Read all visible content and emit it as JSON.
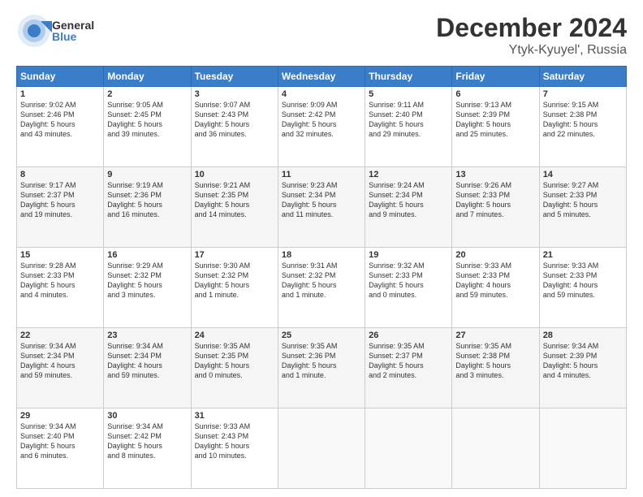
{
  "header": {
    "logo_general": "General",
    "logo_blue": "Blue",
    "title": "December 2024",
    "subtitle": "Ytyk-Kyuyel', Russia"
  },
  "weekdays": [
    "Sunday",
    "Monday",
    "Tuesday",
    "Wednesday",
    "Thursday",
    "Friday",
    "Saturday"
  ],
  "weeks": [
    [
      {
        "day": "1",
        "info": "Sunrise: 9:02 AM\nSunset: 2:46 PM\nDaylight: 5 hours\nand 43 minutes."
      },
      {
        "day": "2",
        "info": "Sunrise: 9:05 AM\nSunset: 2:45 PM\nDaylight: 5 hours\nand 39 minutes."
      },
      {
        "day": "3",
        "info": "Sunrise: 9:07 AM\nSunset: 2:43 PM\nDaylight: 5 hours\nand 36 minutes."
      },
      {
        "day": "4",
        "info": "Sunrise: 9:09 AM\nSunset: 2:42 PM\nDaylight: 5 hours\nand 32 minutes."
      },
      {
        "day": "5",
        "info": "Sunrise: 9:11 AM\nSunset: 2:40 PM\nDaylight: 5 hours\nand 29 minutes."
      },
      {
        "day": "6",
        "info": "Sunrise: 9:13 AM\nSunset: 2:39 PM\nDaylight: 5 hours\nand 25 minutes."
      },
      {
        "day": "7",
        "info": "Sunrise: 9:15 AM\nSunset: 2:38 PM\nDaylight: 5 hours\nand 22 minutes."
      }
    ],
    [
      {
        "day": "8",
        "info": "Sunrise: 9:17 AM\nSunset: 2:37 PM\nDaylight: 5 hours\nand 19 minutes."
      },
      {
        "day": "9",
        "info": "Sunrise: 9:19 AM\nSunset: 2:36 PM\nDaylight: 5 hours\nand 16 minutes."
      },
      {
        "day": "10",
        "info": "Sunrise: 9:21 AM\nSunset: 2:35 PM\nDaylight: 5 hours\nand 14 minutes."
      },
      {
        "day": "11",
        "info": "Sunrise: 9:23 AM\nSunset: 2:34 PM\nDaylight: 5 hours\nand 11 minutes."
      },
      {
        "day": "12",
        "info": "Sunrise: 9:24 AM\nSunset: 2:34 PM\nDaylight: 5 hours\nand 9 minutes."
      },
      {
        "day": "13",
        "info": "Sunrise: 9:26 AM\nSunset: 2:33 PM\nDaylight: 5 hours\nand 7 minutes."
      },
      {
        "day": "14",
        "info": "Sunrise: 9:27 AM\nSunset: 2:33 PM\nDaylight: 5 hours\nand 5 minutes."
      }
    ],
    [
      {
        "day": "15",
        "info": "Sunrise: 9:28 AM\nSunset: 2:33 PM\nDaylight: 5 hours\nand 4 minutes."
      },
      {
        "day": "16",
        "info": "Sunrise: 9:29 AM\nSunset: 2:32 PM\nDaylight: 5 hours\nand 3 minutes."
      },
      {
        "day": "17",
        "info": "Sunrise: 9:30 AM\nSunset: 2:32 PM\nDaylight: 5 hours\nand 1 minute."
      },
      {
        "day": "18",
        "info": "Sunrise: 9:31 AM\nSunset: 2:32 PM\nDaylight: 5 hours\nand 1 minute."
      },
      {
        "day": "19",
        "info": "Sunrise: 9:32 AM\nSunset: 2:33 PM\nDaylight: 5 hours\nand 0 minutes."
      },
      {
        "day": "20",
        "info": "Sunrise: 9:33 AM\nSunset: 2:33 PM\nDaylight: 4 hours\nand 59 minutes."
      },
      {
        "day": "21",
        "info": "Sunrise: 9:33 AM\nSunset: 2:33 PM\nDaylight: 4 hours\nand 59 minutes."
      }
    ],
    [
      {
        "day": "22",
        "info": "Sunrise: 9:34 AM\nSunset: 2:34 PM\nDaylight: 4 hours\nand 59 minutes."
      },
      {
        "day": "23",
        "info": "Sunrise: 9:34 AM\nSunset: 2:34 PM\nDaylight: 4 hours\nand 59 minutes."
      },
      {
        "day": "24",
        "info": "Sunrise: 9:35 AM\nSunset: 2:35 PM\nDaylight: 5 hours\nand 0 minutes."
      },
      {
        "day": "25",
        "info": "Sunrise: 9:35 AM\nSunset: 2:36 PM\nDaylight: 5 hours\nand 1 minute."
      },
      {
        "day": "26",
        "info": "Sunrise: 9:35 AM\nSunset: 2:37 PM\nDaylight: 5 hours\nand 2 minutes."
      },
      {
        "day": "27",
        "info": "Sunrise: 9:35 AM\nSunset: 2:38 PM\nDaylight: 5 hours\nand 3 minutes."
      },
      {
        "day": "28",
        "info": "Sunrise: 9:34 AM\nSunset: 2:39 PM\nDaylight: 5 hours\nand 4 minutes."
      }
    ],
    [
      {
        "day": "29",
        "info": "Sunrise: 9:34 AM\nSunset: 2:40 PM\nDaylight: 5 hours\nand 6 minutes."
      },
      {
        "day": "30",
        "info": "Sunrise: 9:34 AM\nSunset: 2:42 PM\nDaylight: 5 hours\nand 8 minutes."
      },
      {
        "day": "31",
        "info": "Sunrise: 9:33 AM\nSunset: 2:43 PM\nDaylight: 5 hours\nand 10 minutes."
      },
      null,
      null,
      null,
      null
    ]
  ]
}
